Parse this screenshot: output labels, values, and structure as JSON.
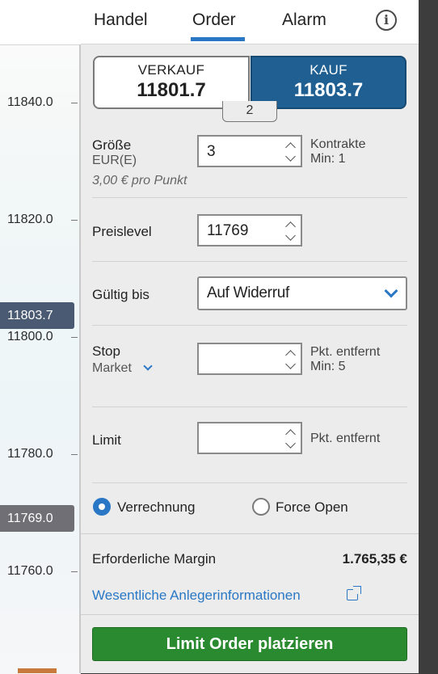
{
  "tabs": [
    {
      "label": "Handel",
      "active": false
    },
    {
      "label": "Order",
      "active": true
    },
    {
      "label": "Alarm",
      "active": false
    }
  ],
  "info_icon": "i",
  "chart": {
    "ticks": [
      "11840.0",
      "11820.0",
      "11800.0",
      "11780.0",
      "11760.0"
    ],
    "current_price": "11803.7",
    "order_level": "11769.0"
  },
  "quote": {
    "sell_label": "VERKAUF",
    "sell_price": "11801.7",
    "buy_label": "KAUF",
    "buy_price": "11803.7",
    "spread": "2",
    "selected": "buy"
  },
  "size": {
    "label": "Größe",
    "currency": "EUR(E)",
    "value": "3",
    "unit": "Kontrakte",
    "min": "Min: 1",
    "per_point": "3,00 € pro Punkt"
  },
  "price_level": {
    "label": "Preislevel",
    "value": "11769"
  },
  "valid_until": {
    "label": "Gültig bis",
    "selected": "Auf Widerruf"
  },
  "stop": {
    "label": "Stop",
    "type": "Market",
    "value": "",
    "unit": "Pkt. entfernt",
    "min": "Min: 5"
  },
  "limit": {
    "label": "Limit",
    "value": "",
    "unit": "Pkt. entfernt"
  },
  "mode": {
    "option1": "Verrechnung",
    "option2": "Force Open",
    "selected": "Verrechnung"
  },
  "margin": {
    "label": "Erforderliche Margin",
    "value": "1.765,35 €"
  },
  "kid_link": "Wesentliche Anlegerinformationen",
  "submit_label": "Limit Order platzieren",
  "colors": {
    "accent": "#2a78c5",
    "buy": "#1f5f92",
    "submit": "#2a8a2f",
    "price_tag": "#4a5a72"
  }
}
